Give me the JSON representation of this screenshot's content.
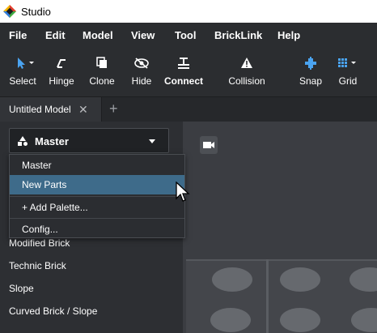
{
  "window": {
    "title": "Studio"
  },
  "menu": [
    "File",
    "Edit",
    "Model",
    "View",
    "Tool",
    "BrickLink",
    "Help"
  ],
  "toolbar": {
    "select": "Select",
    "hinge": "Hinge",
    "clone": "Clone",
    "hide": "Hide",
    "connect": "Connect",
    "collision": "Collision",
    "snap": "Snap",
    "grid": "Grid"
  },
  "tabs": {
    "active": "Untitled Model",
    "close": "✕",
    "add": "+"
  },
  "palette": {
    "selected": "Master",
    "options": [
      "Master",
      "New Parts",
      "+ Add Palette...",
      "Config..."
    ],
    "highlighted": "New Parts"
  },
  "categories": [
    "Modified Brick",
    "Technic Brick",
    "Slope",
    "Curved Brick / Slope"
  ],
  "colors": {
    "accent": "#3e6b8a",
    "select_icon": "#4aa3f0",
    "snap_icon": "#4aa3f0"
  }
}
